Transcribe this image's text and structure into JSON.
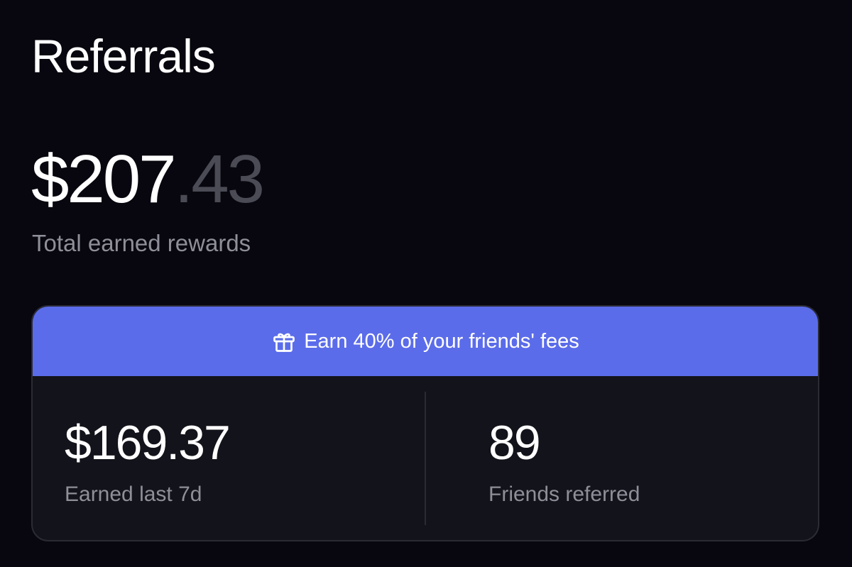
{
  "page": {
    "title": "Referrals"
  },
  "total": {
    "amount_int": "$207",
    "amount_dec": ".43",
    "label": "Total earned rewards"
  },
  "card": {
    "banner": {
      "icon": "gift-icon",
      "text": "Earn 40% of your friends' fees"
    },
    "stats": [
      {
        "value": "$169.37",
        "label": "Earned last 7d"
      },
      {
        "value": "89",
        "label": "Friends referred"
      }
    ]
  },
  "colors": {
    "background": "#08070f",
    "banner": "#5b6cea",
    "card": "#13131b",
    "muted_text": "#8e8f98",
    "muted_decimal": "#4a4b55"
  }
}
